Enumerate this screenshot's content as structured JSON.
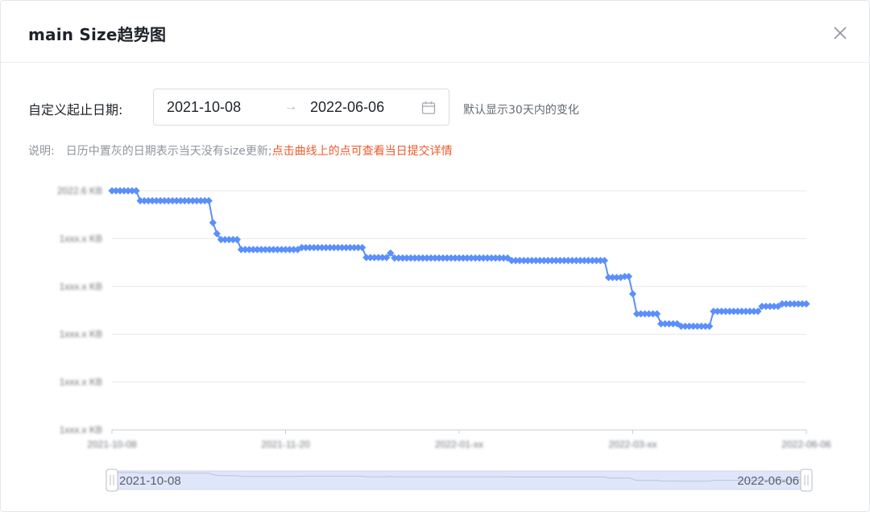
{
  "modal": {
    "title": "main Size趋势图"
  },
  "date_range": {
    "label": "自定义起止日期:",
    "start": "2021-10-08",
    "separator": "→",
    "end": "2022-06-06",
    "hint": "默认显示30天内的变化"
  },
  "note": {
    "label": "说明:",
    "gray_text": "日历中置灰的日期表示当天没有size更新;",
    "red_text": "点击曲线上的点可查看当日提交详情"
  },
  "colors": {
    "series": "#5b8ff9",
    "accent_red": "#f0592b",
    "grid": "#e8e8e8",
    "slider_fill": "#dfe6fb"
  },
  "chart_data": {
    "type": "line",
    "x_start": "2021-10-08",
    "x_end": "2022-06-06",
    "y_tick_labels": [
      "2022.6 KB",
      "1xxx.x KB",
      "1xxx.x KB",
      "1xxx.x KB",
      "1xxx.x KB",
      "1xxx.x KB"
    ],
    "x_tick_labels": [
      "2021-10-08",
      "2021-11-20",
      "2022-01-xx",
      "2022-03-xx",
      "2022-06-06"
    ],
    "series": [
      {
        "values": [
          0.0,
          0.0,
          0.0,
          0.0,
          0.0,
          0.0,
          0.0,
          0.2,
          0.2,
          0.2,
          0.2,
          0.2,
          0.2,
          0.2,
          0.2,
          0.2,
          0.2,
          0.2,
          0.2,
          0.2,
          0.2,
          0.2,
          0.2,
          0.2,
          0.2,
          0.64,
          0.86,
          0.98,
          0.98,
          0.98,
          0.98,
          0.98,
          1.18,
          1.18,
          1.18,
          1.18,
          1.18,
          1.18,
          1.18,
          1.18,
          1.18,
          1.18,
          1.18,
          1.18,
          1.18,
          1.18,
          1.18,
          1.14,
          1.14,
          1.14,
          1.14,
          1.14,
          1.14,
          1.14,
          1.14,
          1.14,
          1.14,
          1.14,
          1.14,
          1.14,
          1.14,
          1.14,
          1.14,
          1.34,
          1.34,
          1.34,
          1.34,
          1.34,
          1.34,
          1.25,
          1.35,
          1.35,
          1.35,
          1.35,
          1.35,
          1.35,
          1.35,
          1.35,
          1.35,
          1.35,
          1.35,
          1.35,
          1.35,
          1.35,
          1.35,
          1.35,
          1.35,
          1.35,
          1.35,
          1.35,
          1.35,
          1.35,
          1.35,
          1.35,
          1.35,
          1.35,
          1.35,
          1.35,
          1.35,
          1.4,
          1.4,
          1.4,
          1.4,
          1.4,
          1.4,
          1.4,
          1.4,
          1.4,
          1.4,
          1.4,
          1.4,
          1.4,
          1.4,
          1.4,
          1.4,
          1.4,
          1.4,
          1.4,
          1.4,
          1.4,
          1.4,
          1.4,
          1.4,
          1.74,
          1.74,
          1.74,
          1.74,
          1.72,
          1.72,
          2.07,
          2.47,
          2.47,
          2.47,
          2.47,
          2.47,
          2.47,
          2.67,
          2.67,
          2.67,
          2.67,
          2.67,
          2.72,
          2.72,
          2.72,
          2.72,
          2.72,
          2.72,
          2.72,
          2.72,
          2.42,
          2.42,
          2.42,
          2.42,
          2.42,
          2.42,
          2.42,
          2.42,
          2.42,
          2.42,
          2.42,
          2.42,
          2.32,
          2.32,
          2.32,
          2.32,
          2.32,
          2.27,
          2.27,
          2.27,
          2.27,
          2.27,
          2.27,
          2.27
        ]
      }
    ],
    "y_range": [
      0,
      4.8
    ],
    "grid": true
  },
  "zoom_slider": {
    "start_label": "2021-10-08",
    "end_label": "2022-06-06"
  }
}
